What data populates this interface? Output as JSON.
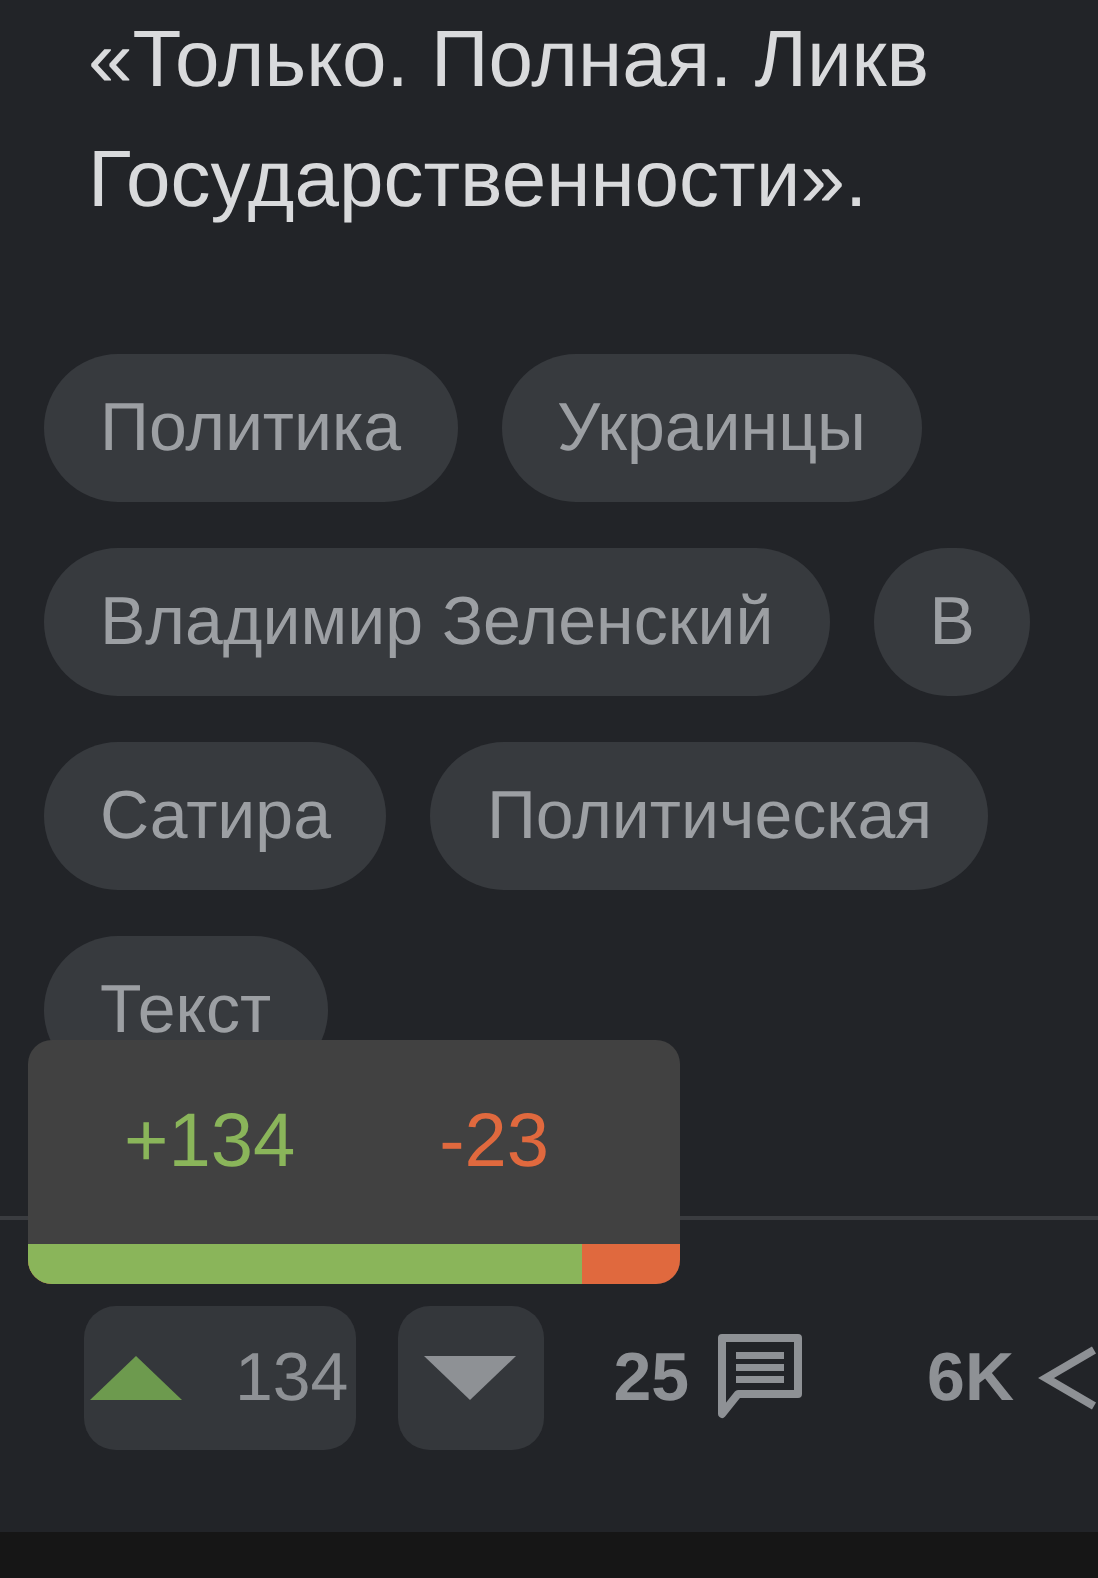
{
  "post_text": "«Только. Полная. Ликв Государственности».",
  "tags": [
    [
      "Политика",
      "Украинцы"
    ],
    [
      "Владимир Зеленский",
      "В"
    ],
    [
      "Сатира",
      "Политическая"
    ],
    [
      "Текст"
    ]
  ],
  "rating_popup": {
    "pluses": "+134",
    "minuses": "-23",
    "level": 0.85
  },
  "actions": {
    "upvotes": "134",
    "comments": "25",
    "views": "6K"
  }
}
